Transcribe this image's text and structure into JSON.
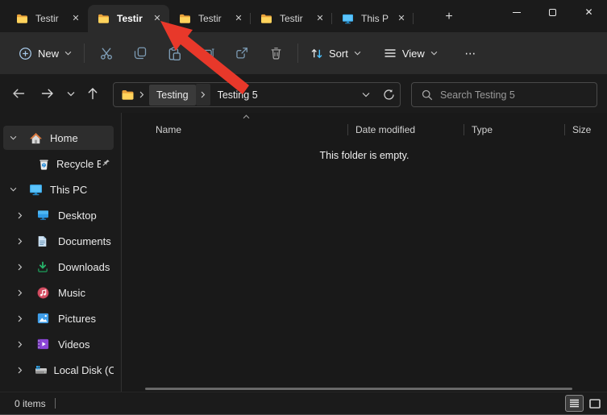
{
  "icons": {
    "close": "✕",
    "new_tab": "+",
    "more": "⋯"
  },
  "colors": {
    "accent": "#4cc2ff",
    "folder_yellow": "#ffd35c",
    "arrow_red": "#e8382a"
  },
  "tabs": {
    "items": [
      {
        "label": "Testir",
        "icon": "folder",
        "active": false
      },
      {
        "label": "Testir",
        "icon": "folder",
        "active": true
      },
      {
        "label": "Testir",
        "icon": "folder",
        "active": false
      },
      {
        "label": "Testir",
        "icon": "folder",
        "active": false
      },
      {
        "label": "This P",
        "icon": "this-pc",
        "active": false
      }
    ]
  },
  "toolbar": {
    "new": "New",
    "sort": "Sort",
    "view": "View"
  },
  "address": {
    "crumbs": [
      "Testing",
      "Testing 5"
    ]
  },
  "search": {
    "placeholder": "Search Testing 5"
  },
  "sidebar": {
    "items": [
      {
        "label": "Home",
        "icon": "home",
        "selected": true
      },
      {
        "label": "Recycle Bin",
        "icon": "recycle-bin",
        "pinned": true
      },
      {
        "label": "This PC",
        "icon": "this-pc"
      },
      {
        "label": "Desktop",
        "icon": "desktop"
      },
      {
        "label": "Documents",
        "icon": "documents"
      },
      {
        "label": "Downloads",
        "icon": "downloads"
      },
      {
        "label": "Music",
        "icon": "music"
      },
      {
        "label": "Pictures",
        "icon": "pictures"
      },
      {
        "label": "Videos",
        "icon": "videos"
      },
      {
        "label": "Local Disk (C:)",
        "icon": "local-disk"
      }
    ]
  },
  "content": {
    "columns": [
      "Name",
      "Date modified",
      "Type",
      "Size"
    ],
    "empty_message": "This folder is empty."
  },
  "status": {
    "items_count": "0 items"
  }
}
